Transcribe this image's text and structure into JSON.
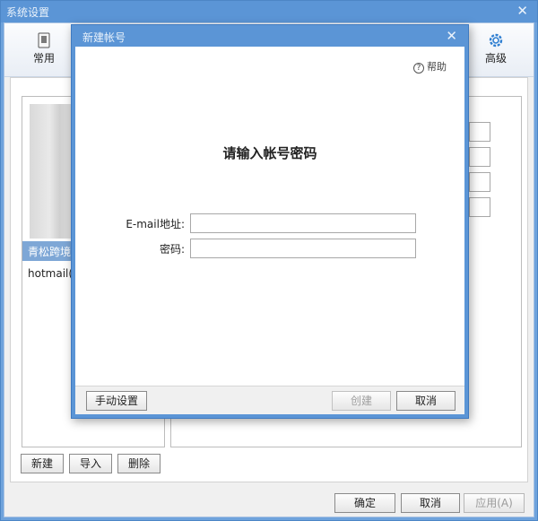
{
  "outer": {
    "title": "系统设置",
    "close_glyph": "✕",
    "toolbar": {
      "common_label": "常用",
      "advanced_label": "高级"
    },
    "accounts": [
      {
        "label": "青松跨境"
      },
      {
        "label": "hotmail(c"
      }
    ],
    "buttons": {
      "new": "新建",
      "import": "导入",
      "delete": "删除",
      "ok": "确定",
      "cancel": "取消",
      "apply": "应用(A)"
    }
  },
  "dialog": {
    "title": "新建帐号",
    "close_glyph": "✕",
    "help_label": "帮助",
    "heading": "请输入帐号密码",
    "email_label": "E-mail地址:",
    "password_label": "密码:",
    "email_value": "",
    "password_value": "",
    "buttons": {
      "manual": "手动设置",
      "create": "创建",
      "cancel": "取消"
    }
  },
  "icons": {
    "common": "document-icon",
    "advanced": "gear-icon",
    "help": "question-circle-icon"
  },
  "colors": {
    "titlebar": "#5b95d6",
    "selection": "#7ea7d6",
    "disabled_text": "#a0a0a0"
  }
}
